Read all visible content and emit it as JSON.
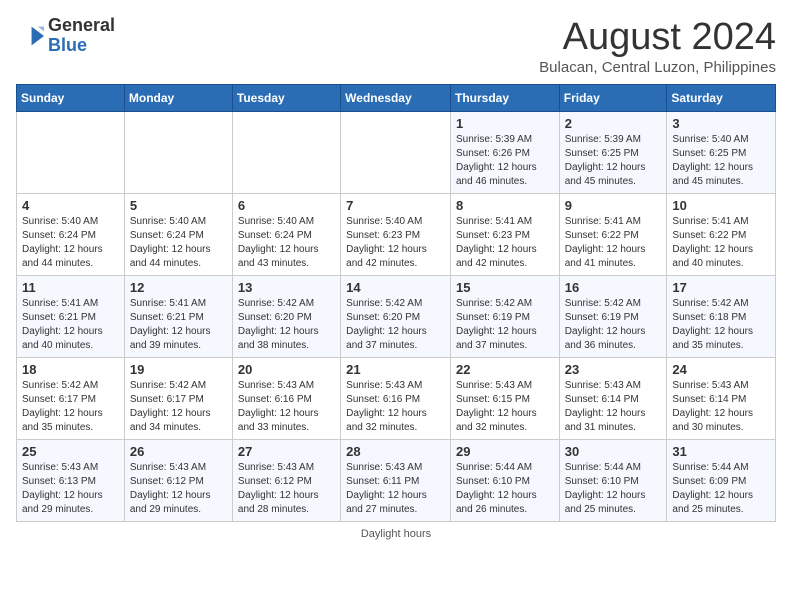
{
  "header": {
    "logo_general": "General",
    "logo_blue": "Blue",
    "month_year": "August 2024",
    "location": "Bulacan, Central Luzon, Philippines"
  },
  "days_of_week": [
    "Sunday",
    "Monday",
    "Tuesday",
    "Wednesday",
    "Thursday",
    "Friday",
    "Saturday"
  ],
  "weeks": [
    [
      {
        "day": "",
        "info": ""
      },
      {
        "day": "",
        "info": ""
      },
      {
        "day": "",
        "info": ""
      },
      {
        "day": "",
        "info": ""
      },
      {
        "day": "1",
        "info": "Sunrise: 5:39 AM\nSunset: 6:26 PM\nDaylight: 12 hours\nand 46 minutes."
      },
      {
        "day": "2",
        "info": "Sunrise: 5:39 AM\nSunset: 6:25 PM\nDaylight: 12 hours\nand 45 minutes."
      },
      {
        "day": "3",
        "info": "Sunrise: 5:40 AM\nSunset: 6:25 PM\nDaylight: 12 hours\nand 45 minutes."
      }
    ],
    [
      {
        "day": "4",
        "info": "Sunrise: 5:40 AM\nSunset: 6:24 PM\nDaylight: 12 hours\nand 44 minutes."
      },
      {
        "day": "5",
        "info": "Sunrise: 5:40 AM\nSunset: 6:24 PM\nDaylight: 12 hours\nand 44 minutes."
      },
      {
        "day": "6",
        "info": "Sunrise: 5:40 AM\nSunset: 6:24 PM\nDaylight: 12 hours\nand 43 minutes."
      },
      {
        "day": "7",
        "info": "Sunrise: 5:40 AM\nSunset: 6:23 PM\nDaylight: 12 hours\nand 42 minutes."
      },
      {
        "day": "8",
        "info": "Sunrise: 5:41 AM\nSunset: 6:23 PM\nDaylight: 12 hours\nand 42 minutes."
      },
      {
        "day": "9",
        "info": "Sunrise: 5:41 AM\nSunset: 6:22 PM\nDaylight: 12 hours\nand 41 minutes."
      },
      {
        "day": "10",
        "info": "Sunrise: 5:41 AM\nSunset: 6:22 PM\nDaylight: 12 hours\nand 40 minutes."
      }
    ],
    [
      {
        "day": "11",
        "info": "Sunrise: 5:41 AM\nSunset: 6:21 PM\nDaylight: 12 hours\nand 40 minutes."
      },
      {
        "day": "12",
        "info": "Sunrise: 5:41 AM\nSunset: 6:21 PM\nDaylight: 12 hours\nand 39 minutes."
      },
      {
        "day": "13",
        "info": "Sunrise: 5:42 AM\nSunset: 6:20 PM\nDaylight: 12 hours\nand 38 minutes."
      },
      {
        "day": "14",
        "info": "Sunrise: 5:42 AM\nSunset: 6:20 PM\nDaylight: 12 hours\nand 37 minutes."
      },
      {
        "day": "15",
        "info": "Sunrise: 5:42 AM\nSunset: 6:19 PM\nDaylight: 12 hours\nand 37 minutes."
      },
      {
        "day": "16",
        "info": "Sunrise: 5:42 AM\nSunset: 6:19 PM\nDaylight: 12 hours\nand 36 minutes."
      },
      {
        "day": "17",
        "info": "Sunrise: 5:42 AM\nSunset: 6:18 PM\nDaylight: 12 hours\nand 35 minutes."
      }
    ],
    [
      {
        "day": "18",
        "info": "Sunrise: 5:42 AM\nSunset: 6:17 PM\nDaylight: 12 hours\nand 35 minutes."
      },
      {
        "day": "19",
        "info": "Sunrise: 5:42 AM\nSunset: 6:17 PM\nDaylight: 12 hours\nand 34 minutes."
      },
      {
        "day": "20",
        "info": "Sunrise: 5:43 AM\nSunset: 6:16 PM\nDaylight: 12 hours\nand 33 minutes."
      },
      {
        "day": "21",
        "info": "Sunrise: 5:43 AM\nSunset: 6:16 PM\nDaylight: 12 hours\nand 32 minutes."
      },
      {
        "day": "22",
        "info": "Sunrise: 5:43 AM\nSunset: 6:15 PM\nDaylight: 12 hours\nand 32 minutes."
      },
      {
        "day": "23",
        "info": "Sunrise: 5:43 AM\nSunset: 6:14 PM\nDaylight: 12 hours\nand 31 minutes."
      },
      {
        "day": "24",
        "info": "Sunrise: 5:43 AM\nSunset: 6:14 PM\nDaylight: 12 hours\nand 30 minutes."
      }
    ],
    [
      {
        "day": "25",
        "info": "Sunrise: 5:43 AM\nSunset: 6:13 PM\nDaylight: 12 hours\nand 29 minutes."
      },
      {
        "day": "26",
        "info": "Sunrise: 5:43 AM\nSunset: 6:12 PM\nDaylight: 12 hours\nand 29 minutes."
      },
      {
        "day": "27",
        "info": "Sunrise: 5:43 AM\nSunset: 6:12 PM\nDaylight: 12 hours\nand 28 minutes."
      },
      {
        "day": "28",
        "info": "Sunrise: 5:43 AM\nSunset: 6:11 PM\nDaylight: 12 hours\nand 27 minutes."
      },
      {
        "day": "29",
        "info": "Sunrise: 5:44 AM\nSunset: 6:10 PM\nDaylight: 12 hours\nand 26 minutes."
      },
      {
        "day": "30",
        "info": "Sunrise: 5:44 AM\nSunset: 6:10 PM\nDaylight: 12 hours\nand 25 minutes."
      },
      {
        "day": "31",
        "info": "Sunrise: 5:44 AM\nSunset: 6:09 PM\nDaylight: 12 hours\nand 25 minutes."
      }
    ]
  ],
  "footer": "Daylight hours"
}
